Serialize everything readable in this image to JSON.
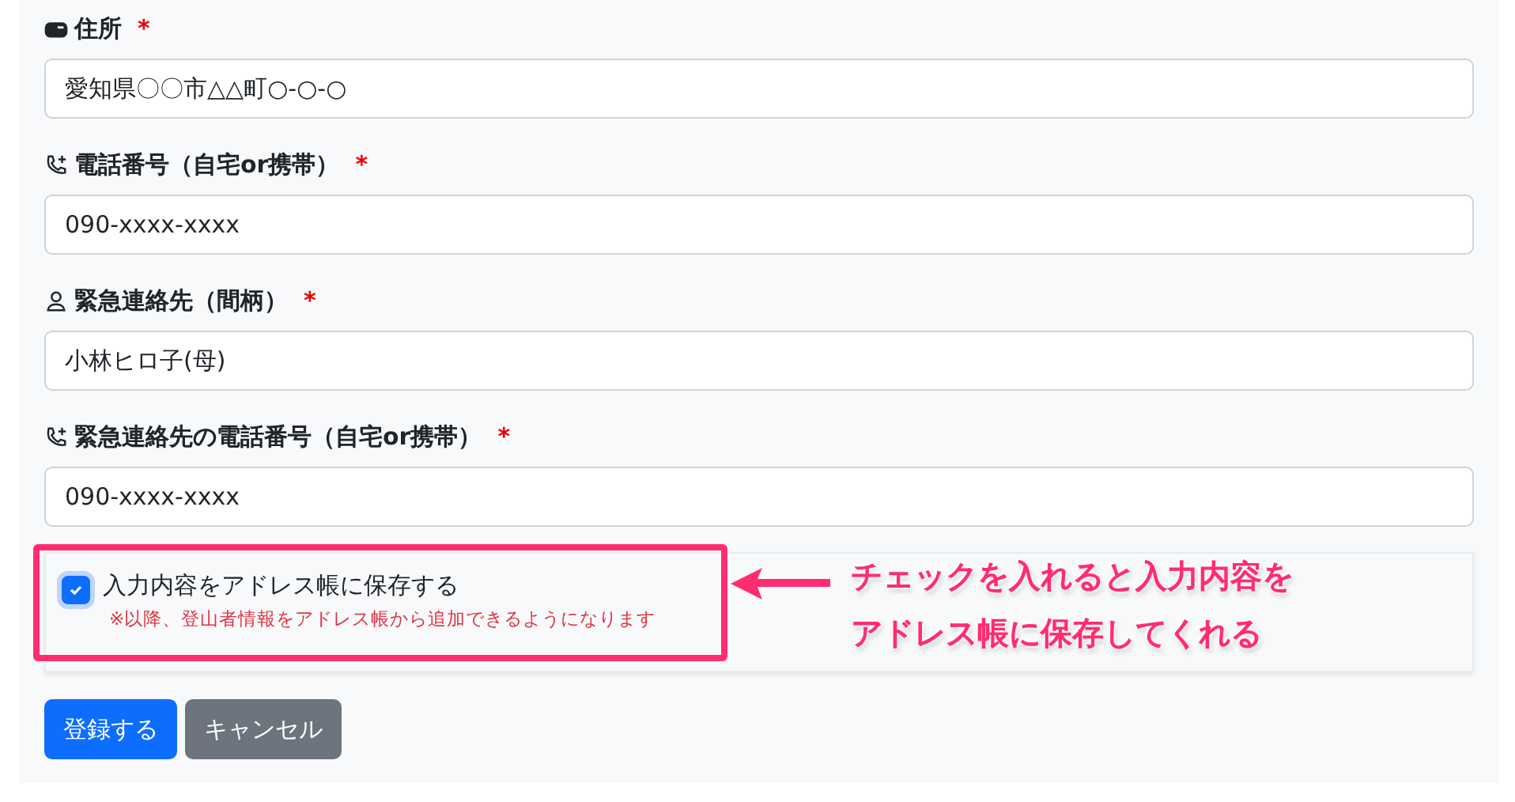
{
  "fields": [
    {
      "kind": "address",
      "label": "住所",
      "required": true,
      "value": "愛知県〇〇市△△町○-○-○"
    },
    {
      "kind": "phone",
      "label": "電話番号（自宅or携帯）",
      "required": true,
      "value": "090-xxxx-xxxx"
    },
    {
      "kind": "person",
      "label": "緊急連絡先（間柄）",
      "required": true,
      "value": "小林ヒロ子(母)"
    },
    {
      "kind": "phone",
      "label": "緊急連絡先の電話番号（自宅or携帯）",
      "required": true,
      "value": "090-xxxx-xxxx"
    }
  ],
  "required_mark": "*",
  "save_option": {
    "label": "入力内容をアドレス帳に保存する",
    "checked": true,
    "note": "※以降、登山者情報をアドレス帳から追加できるようになります"
  },
  "annotation": {
    "lines": [
      "チェックを入れると入力内容を",
      "アドレス帳に保存してくれる"
    ]
  },
  "buttons": [
    {
      "kind": "primary",
      "label": "登録する"
    },
    {
      "kind": "secondary",
      "label": "キャンセル"
    }
  ]
}
